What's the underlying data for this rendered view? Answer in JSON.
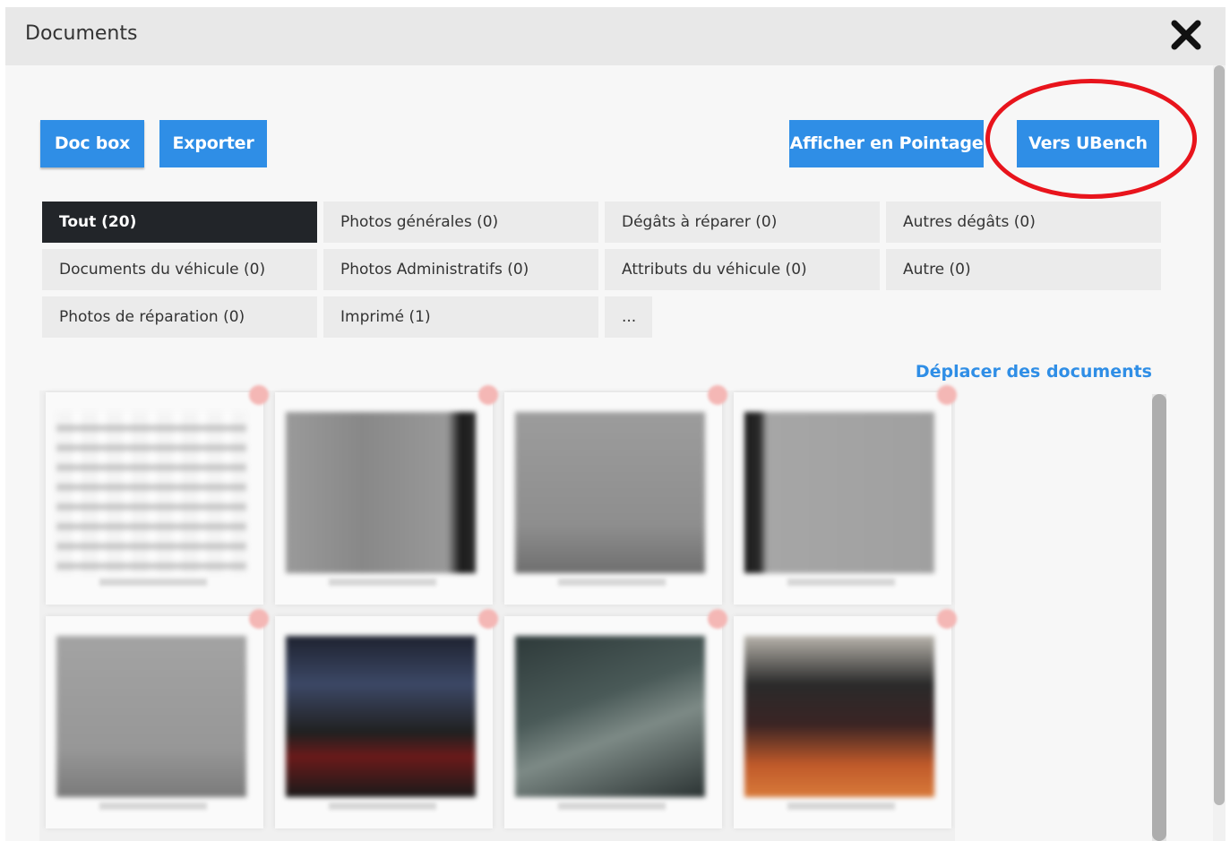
{
  "window": {
    "title": "Documents"
  },
  "toolbar": {
    "doc_box": "Doc box",
    "export": "Exporter",
    "show_pointage": "Afficher en Pointage",
    "to_ubench": "Vers UBench"
  },
  "categories": [
    "Tout (20)",
    "Photos générales (0)",
    "Dégâts à réparer (0)",
    "Autres dégâts (0)",
    "Documents du véhicule (0)",
    "Photos Administratifs (0)",
    "Attributs du véhicule (0)",
    "Autre (0)",
    "Photos de réparation (0)",
    "Imprimé (1)",
    "..."
  ],
  "actions": {
    "move_documents": "Déplacer des documents"
  },
  "colors": {
    "accent": "#2f8ee6",
    "active_tab": "#222529",
    "highlight_ring": "#e8141c"
  },
  "icons": {
    "close": "close-icon",
    "delete": "delete-badge-icon"
  }
}
